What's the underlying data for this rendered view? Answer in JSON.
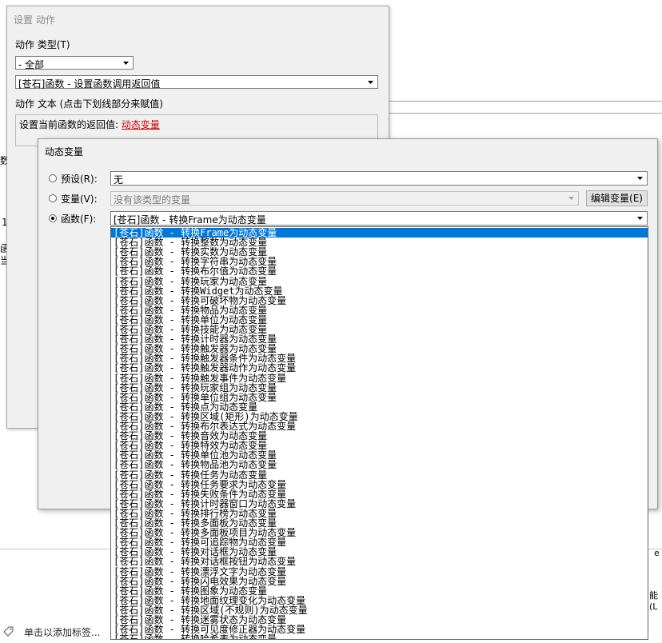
{
  "background": {
    "frag1": "数",
    "frag2": "1",
    "frag3": "函",
    "frag4": "当",
    "bottom_hint": "单击以添加标签...",
    "frag_right1": "能(L",
    "frag_right2": "e"
  },
  "dialog1": {
    "title": "设置 动作",
    "action_type_label": "动作 类型(T)",
    "category_value": "- 全部",
    "action_value": "[苍石]函数 - 设置函数调用返回值",
    "action_text_label": "动作 文本 (点击下划线部分来赋值)",
    "action_text_prefix": "设置当前函数的返回值: ",
    "action_text_link": "动态变量"
  },
  "dialog2": {
    "title": "动态变量",
    "preset_label": "预设(R):",
    "preset_value": "无",
    "variable_label": "变量(V):",
    "variable_value": "没有该类型的变量",
    "edit_variable_button": "编辑变量(E)",
    "function_label": "函数(F):",
    "function_value": "[苍石]函数 - 转换Frame为动态变量"
  },
  "dropdown": {
    "items": [
      "[苍石]函数 - 转换Frame为动态变量",
      "[苍石]函数 - 转换整数为动态变量",
      "[苍石]函数 - 转换实数为动态变量",
      "[苍石]函数 - 转换字符串为动态变量",
      "[苍石]函数 - 转换布尔值为动态变量",
      "[苍石]函数 - 转换玩家为动态变量",
      "[苍石]函数 - 转换Widget为动态变量",
      "[苍石]函数 - 转换可破坏物为动态变量",
      "[苍石]函数 - 转换物品为动态变量",
      "[苍石]函数 - 转换单位为动态变量",
      "[苍石]函数 - 转换技能为动态变量",
      "[苍石]函数 - 转换计时器为动态变量",
      "[苍石]函数 - 转换触发器为动态变量",
      "[苍石]函数 - 转换触发器条件为动态变量",
      "[苍石]函数 - 转换触发器动作为动态变量",
      "[苍石]函数 - 转换触发事件为动态变量",
      "[苍石]函数 - 转换玩家组为动态变量",
      "[苍石]函数 - 转换单位组为动态变量",
      "[苍石]函数 - 转换点为动态变量",
      "[苍石]函数 - 转换区域(矩形)为动态变量",
      "[苍石]函数 - 转换布尔表达式为动态变量",
      "[苍石]函数 - 转换音效为动态变量",
      "[苍石]函数 - 转换特效为动态变量",
      "[苍石]函数 - 转换单位池为动态变量",
      "[苍石]函数 - 转换物品池为动态变量",
      "[苍石]函数 - 转换任务为动态变量",
      "[苍石]函数 - 转换任务要求为动态变量",
      "[苍石]函数 - 转换失败条件为动态变量",
      "[苍石]函数 - 转换计时器窗口为动态变量",
      "[苍石]函数 - 转换排行榜为动态变量",
      "[苍石]函数 - 转换多面板为动态变量",
      "[苍石]函数 - 转换多面板项目为动态变量",
      "[苍石]函数 - 转换可追踪物为动态变量",
      "[苍石]函数 - 转换对话框为动态变量",
      "[苍石]函数 - 转换对话框按钮为动态变量",
      "[苍石]函数 - 转换漂浮文字为动态变量",
      "[苍石]函数 - 转换闪电效果为动态变量",
      "[苍石]函数 - 转换图象为动态变量",
      "[苍石]函数 - 转换地面纹理变化为动态变量",
      "[苍石]函数 - 转换区域(不规则)为动态变量",
      "[苍石]函数 - 转换迷雾状态为动态变量",
      "[苍石]函数 - 转换可见度修正器为动态变量",
      "[苍石]函数 - 转换哈希表为动态变量"
    ]
  }
}
